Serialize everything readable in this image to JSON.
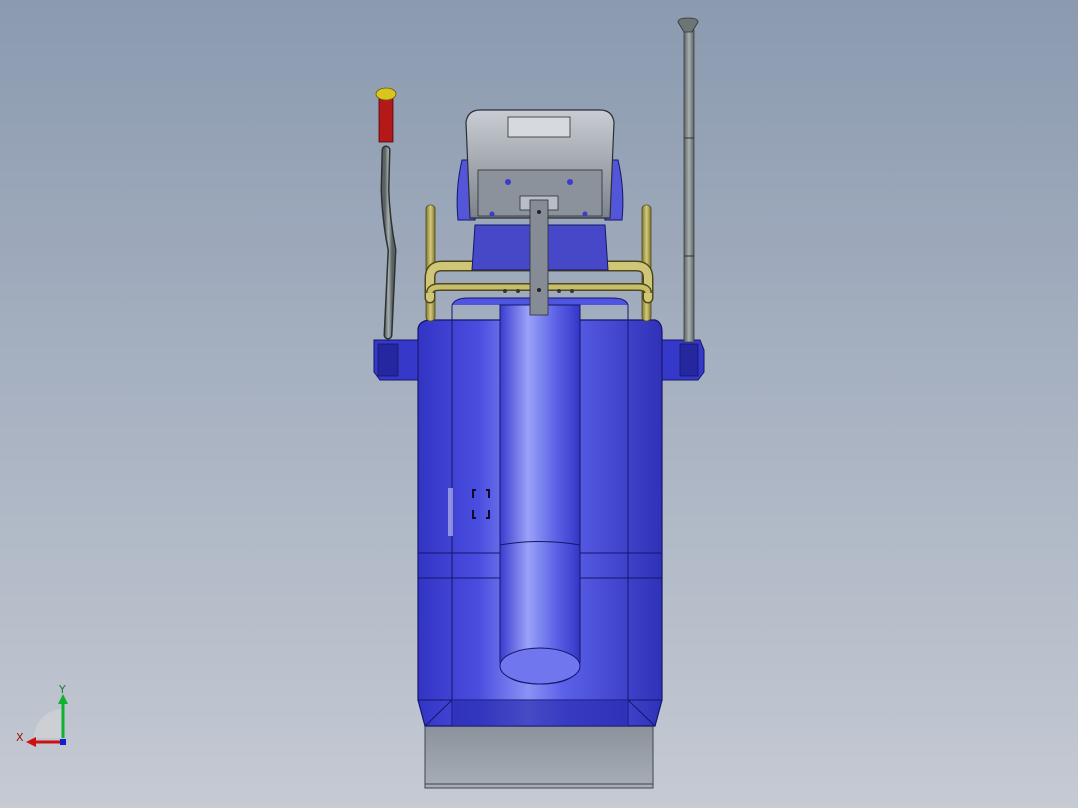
{
  "viewport": {
    "background_top": "#8b9ab0",
    "background_bottom": "#c5cad3"
  },
  "model": {
    "body_color": "#3d3fd0",
    "frame_color": "#a99f4a",
    "grip_color": "#b01818",
    "rod_color": "#7c8383",
    "base_color": "#9aa0a8"
  },
  "triad": {
    "x_label": "X",
    "y_label": "Y",
    "x_color": "#d01010",
    "y_color": "#10b030",
    "z_color": "#1020d0"
  }
}
